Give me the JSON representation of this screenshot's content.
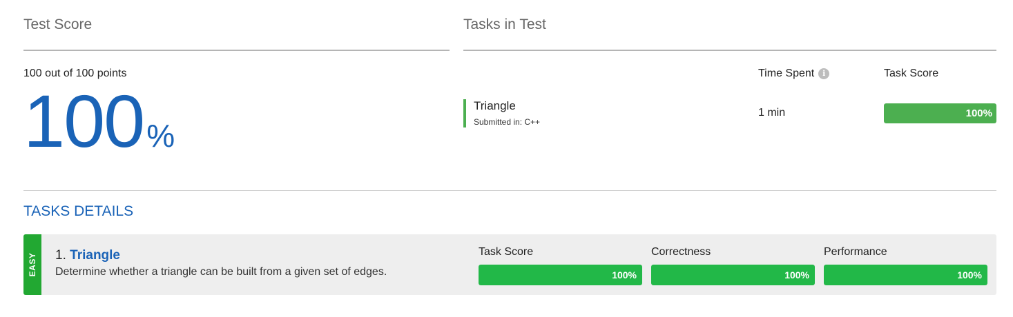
{
  "test_score": {
    "title": "Test Score",
    "points_text": "100 out of 100 points",
    "percent_value": "100",
    "percent_sign": "%"
  },
  "tasks_in_test": {
    "title": "Tasks in Test",
    "headers": {
      "time_spent": "Time Spent",
      "task_score": "Task Score"
    },
    "info_icon": "info-icon",
    "tasks": [
      {
        "name": "Triangle",
        "submitted_in": "Submitted in: C++",
        "time_spent": "1 min",
        "score_label": "100%",
        "score_fraction": 1.0
      }
    ]
  },
  "tasks_details": {
    "title": "TASKS DETAILS",
    "items": [
      {
        "difficulty": "EASY",
        "number": "1.",
        "name": "Triangle",
        "description": "Determine whether a triangle can be built from a given set of edges.",
        "metrics": [
          {
            "label": "Task Score",
            "value": "100%",
            "fraction": 1.0
          },
          {
            "label": "Correctness",
            "value": "100%",
            "fraction": 1.0
          },
          {
            "label": "Performance",
            "value": "100%",
            "fraction": 1.0
          }
        ]
      }
    ]
  },
  "colors": {
    "accent_blue": "#1a63b7",
    "success_green": "#4caf50",
    "metric_green": "#22b848",
    "difficulty_easy": "#22a832"
  }
}
